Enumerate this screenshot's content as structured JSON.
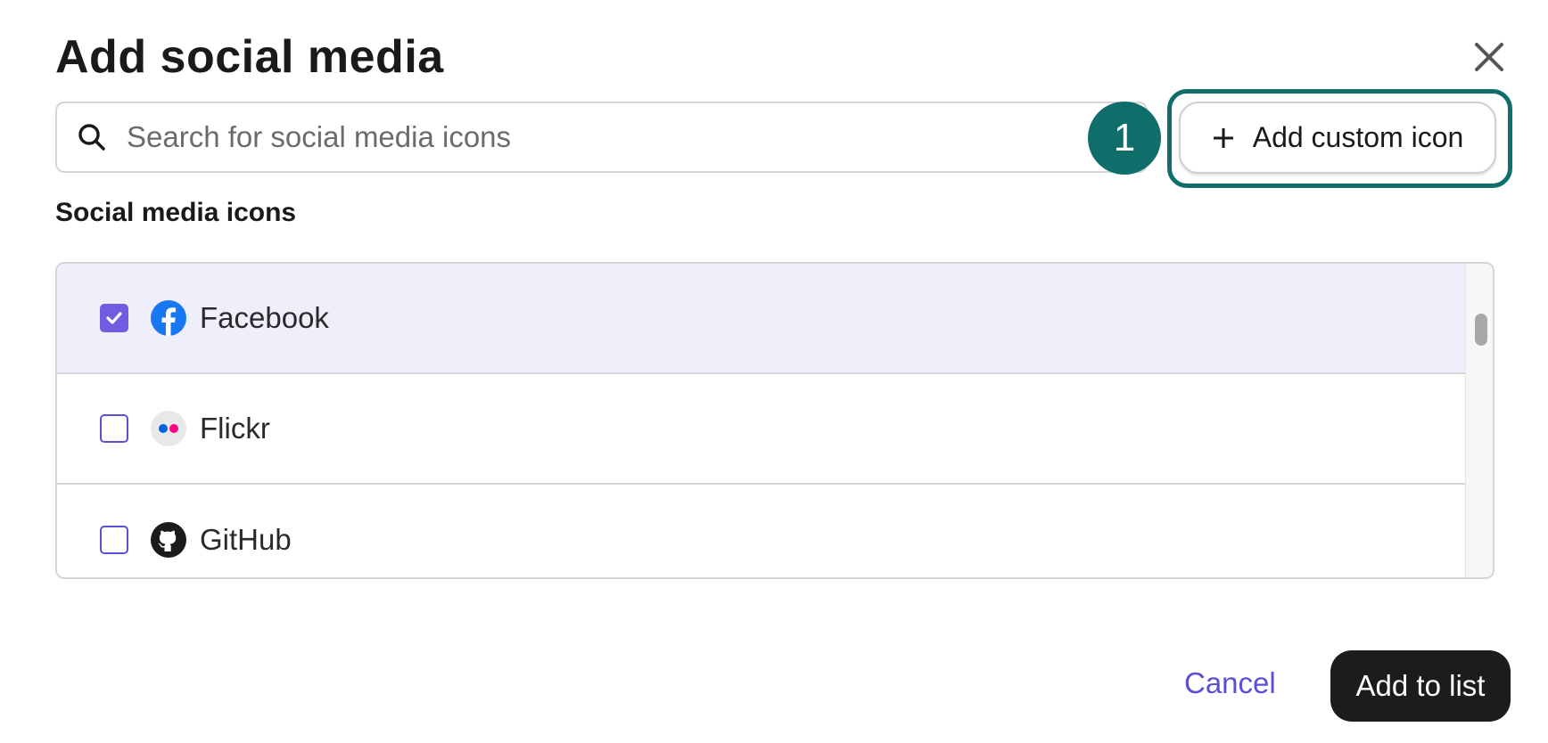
{
  "dialog": {
    "title": "Add social media",
    "close_icon": "close-icon"
  },
  "search": {
    "placeholder": "Search for social media icons",
    "value": "",
    "icon": "search-icon"
  },
  "annotation": {
    "step_number": "1",
    "color": "#0f6e6a"
  },
  "custom_button": {
    "icon": "plus-icon",
    "label": "Add custom icon"
  },
  "section": {
    "label": "Social media icons"
  },
  "items": [
    {
      "label": "Facebook",
      "checked": true,
      "icon": "facebook-icon"
    },
    {
      "label": "Flickr",
      "checked": false,
      "icon": "flickr-icon"
    },
    {
      "label": "GitHub",
      "checked": false,
      "icon": "github-icon"
    }
  ],
  "footer": {
    "cancel_label": "Cancel",
    "submit_label": "Add to list"
  },
  "colors": {
    "accent": "#5b4fd6",
    "selected_row": "#efeefb",
    "primary_button": "#1c1c1c",
    "annotation": "#0f6e6a",
    "facebook": "#1877f2",
    "flickr_blue": "#0063dc",
    "flickr_pink": "#ff0084"
  }
}
